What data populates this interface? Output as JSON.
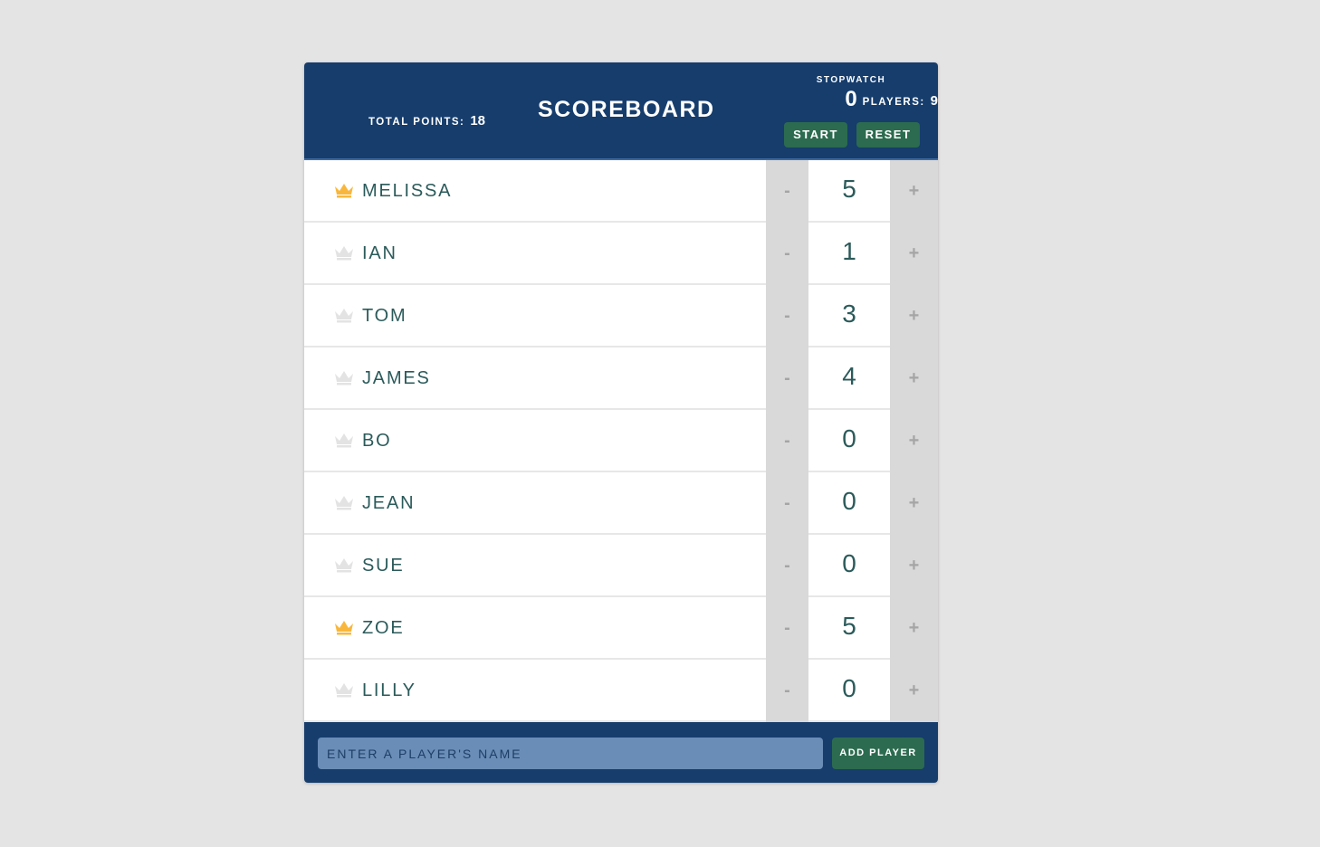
{
  "header": {
    "stats": {
      "players_label": "Players:",
      "players_value": "9",
      "points_label": "Total Points:",
      "points_value": "18"
    },
    "title": "SCOREBOARD",
    "stopwatch": {
      "label": "STOPWATCH",
      "time": "0",
      "start_label": "START",
      "reset_label": "RESET"
    }
  },
  "players": [
    {
      "name": "MELISSA",
      "score": "5",
      "leader": true
    },
    {
      "name": "IAN",
      "score": "1",
      "leader": false
    },
    {
      "name": "TOM",
      "score": "3",
      "leader": false
    },
    {
      "name": "JAMES",
      "score": "4",
      "leader": false
    },
    {
      "name": "BO",
      "score": "0",
      "leader": false
    },
    {
      "name": "JEAN",
      "score": "0",
      "leader": false
    },
    {
      "name": "SUE",
      "score": "0",
      "leader": false
    },
    {
      "name": "ZOE",
      "score": "5",
      "leader": true
    },
    {
      "name": "LILLY",
      "score": "0",
      "leader": false
    }
  ],
  "counter": {
    "decrement_label": "-",
    "increment_label": "+"
  },
  "footer": {
    "input_placeholder": "ENTER A PLAYER'S NAME",
    "input_value": "",
    "add_label": "ADD PLAYER"
  },
  "colors": {
    "header_bg": "#163d6c",
    "accent_green": "#2c6b4f",
    "crown_leader": "#f8b73c",
    "crown_default": "#e3e3e3",
    "text": "#2b5a5a"
  },
  "icons": {
    "crown": "crown-icon"
  }
}
